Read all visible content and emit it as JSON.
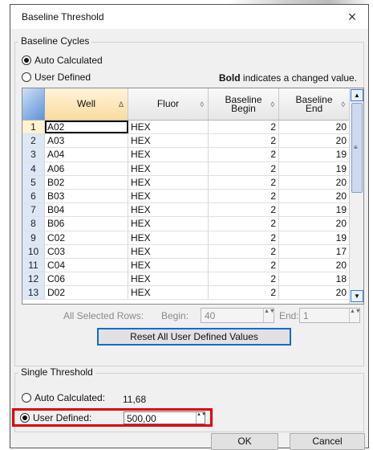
{
  "dialog": {
    "title": "Baseline Threshold",
    "close_glyph": "×"
  },
  "baseline_cycles": {
    "legend": "Baseline Cycles",
    "auto_label": "Auto Calculated",
    "user_label": "User Defined",
    "selected": "auto",
    "note_bold": "Bold",
    "note_rest": " indicates a changed value."
  },
  "table": {
    "columns": [
      {
        "label": "Well",
        "sort": "Δ"
      },
      {
        "label": "Fluor",
        "sort": "◊"
      },
      {
        "label": "Baseline Begin",
        "line1": "Baseline",
        "line2": "Begin",
        "sort": "◊"
      },
      {
        "label": "Baseline End",
        "line1": "Baseline",
        "line2": "End",
        "sort": "◊"
      }
    ],
    "rows": [
      {
        "num": "1",
        "well": "A02",
        "fluor": "HEX",
        "begin": "2",
        "end": "20"
      },
      {
        "num": "2",
        "well": "A03",
        "fluor": "HEX",
        "begin": "2",
        "end": "20"
      },
      {
        "num": "3",
        "well": "A04",
        "fluor": "HEX",
        "begin": "2",
        "end": "19"
      },
      {
        "num": "4",
        "well": "A06",
        "fluor": "HEX",
        "begin": "2",
        "end": "19"
      },
      {
        "num": "5",
        "well": "B02",
        "fluor": "HEX",
        "begin": "2",
        "end": "20"
      },
      {
        "num": "6",
        "well": "B03",
        "fluor": "HEX",
        "begin": "2",
        "end": "20"
      },
      {
        "num": "7",
        "well": "B04",
        "fluor": "HEX",
        "begin": "2",
        "end": "19"
      },
      {
        "num": "8",
        "well": "B06",
        "fluor": "HEX",
        "begin": "2",
        "end": "20"
      },
      {
        "num": "9",
        "well": "C02",
        "fluor": "HEX",
        "begin": "2",
        "end": "19"
      },
      {
        "num": "10",
        "well": "C03",
        "fluor": "HEX",
        "begin": "2",
        "end": "17"
      },
      {
        "num": "11",
        "well": "C04",
        "fluor": "HEX",
        "begin": "2",
        "end": "20"
      },
      {
        "num": "12",
        "well": "C06",
        "fluor": "HEX",
        "begin": "2",
        "end": "18"
      },
      {
        "num": "13",
        "well": "D02",
        "fluor": "HEX",
        "begin": "2",
        "end": "20"
      }
    ],
    "scroll_up_glyph": "▲",
    "scroll_down_glyph": "▼",
    "scroll_grip_glyph": "≡"
  },
  "all_selected": {
    "label": "All Selected Rows:",
    "begin_label": "Begin:",
    "begin_value": "40",
    "end_label": "End:",
    "end_value": "1",
    "spin_glyph": "▲▼"
  },
  "reset_button": "Reset All User Defined Values",
  "single_threshold": {
    "legend": "Single Threshold",
    "auto_label": "Auto Calculated:",
    "auto_value": "11,68",
    "user_label": "User Defined:",
    "user_value": "500,00",
    "selected": "user"
  },
  "buttons": {
    "ok": "OK",
    "cancel": "Cancel"
  },
  "colors": {
    "highlight": "#e00000",
    "accent": "#0f6cd0"
  }
}
